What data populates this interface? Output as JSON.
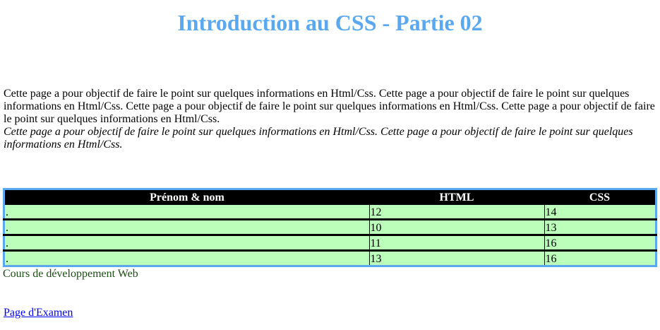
{
  "title": "Introduction au CSS - Partie 02",
  "intro": {
    "paragraph": "Cette page a pour objectif de faire le point sur quelques informations en Html/Css. Cette page a pour objectif de faire le point sur quelques informations en Html/Css. Cette page a pour objectif de faire le point sur quelques informations en Html/Css. Cette page a pour objectif de faire le point sur quelques informations en Html/Css.",
    "italic": "Cette page a pour objectif de faire le point sur quelques informations en Html/Css. Cette page a pour objectif de faire le point sur quelques informations en Html/Css."
  },
  "table": {
    "headers": [
      "Prénom & nom",
      "HTML",
      "CSS"
    ],
    "rows": [
      [
        ".",
        "12",
        "14"
      ],
      [
        ".",
        "10",
        "13"
      ],
      [
        ".",
        "11",
        "16"
      ],
      [
        ".",
        "13",
        "16"
      ]
    ],
    "caption": "Cours de développement Web"
  },
  "link": "Page d'Examen"
}
